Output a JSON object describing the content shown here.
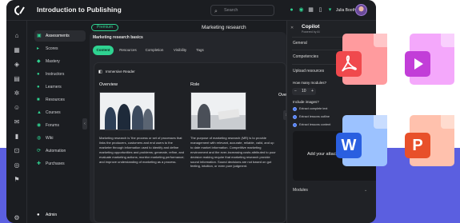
{
  "app": {
    "title": "Introduction to Publishing",
    "search_placeholder": "Search",
    "user_name": "Julia Booth"
  },
  "topbar_icons": [
    "bell-icon",
    "chat-icon",
    "calendar-icon",
    "trash-icon",
    "cart-icon"
  ],
  "rail_icons": [
    "home-icon",
    "grid-icon",
    "layers-icon",
    "book-icon",
    "settings-icon",
    "users-icon",
    "mail-icon",
    "chart-icon",
    "cart-icon",
    "globe-icon",
    "flag-icon",
    "gear-icon"
  ],
  "sidebar": {
    "items": [
      {
        "label": "Assessments",
        "icon": "clipboard-icon",
        "active": true
      },
      {
        "label": "Scores",
        "icon": "score-icon"
      },
      {
        "label": "Mastery",
        "icon": "mastery-icon"
      },
      {
        "label": "Instructors",
        "icon": "instructor-icon"
      },
      {
        "label": "Learners",
        "icon": "learners-icon"
      },
      {
        "label": "Resources",
        "icon": "resources-icon"
      },
      {
        "label": "Courses",
        "icon": "courses-icon"
      },
      {
        "label": "Forums",
        "icon": "forums-icon"
      },
      {
        "label": "Wiki",
        "icon": "wiki-icon"
      },
      {
        "label": "Automation",
        "icon": "automation-icon"
      },
      {
        "label": "Purchases",
        "icon": "purchases-icon"
      }
    ],
    "footer": "Admin"
  },
  "main": {
    "pill": "Premium",
    "title": "Marketing research",
    "card_subtitle": "Marketing research basics",
    "tabs": [
      "Content",
      "Resources",
      "Completion",
      "Visibility",
      "Tags"
    ],
    "inner_header": "Immersive Reader",
    "overview_heading": "Overview",
    "role_heading": "Role",
    "overview_text": "Marketing research is 'the process or set of processes that links the producers, customers and end users to the marketer through information used to identify and define marketing opportunities and problems; generate, refine, and evaluate marketing actions; monitor marketing performance; and improve understanding of marketing as a process.",
    "role_text": "The purpose of marketing research (MR) is to provide management with relevant, accurate, reliable, valid, and up to date market information. Competitive marketing environment and the ever-increasing costs attributed to poor decision making require that marketing research provide sound information. Sound decisions are not based on gut feeling, intuition, or even pure judgment.",
    "overview_right": "Overv"
  },
  "copilot": {
    "title": "Copilot",
    "subtitle": "Powered by AI",
    "rows": [
      "General",
      "Competencies",
      "Upload resources"
    ],
    "questions_label": "How many modules?",
    "questions_value": "10",
    "include_label": "Include images?",
    "radio_options": [
      "Extract complete text",
      "Extract lessons outline",
      "Extract lessons content"
    ],
    "upload_label": "Add your attachm",
    "modules_label": "Modules"
  },
  "file_icons": [
    {
      "name": "pdf-file-icon",
      "color": "#f0494d",
      "sheet": "#ff9b9e",
      "glyph": "acrobat"
    },
    {
      "name": "video-file-icon",
      "color": "#c23ed8",
      "sheet": "#f4a8fb",
      "glyph": "play"
    },
    {
      "name": "word-file-icon",
      "color": "#2a5fe0",
      "sheet": "#9cc2ff",
      "glyph": "W"
    },
    {
      "name": "powerpoint-file-icon",
      "color": "#e8502a",
      "sheet": "#ffc1ad",
      "glyph": "P"
    }
  ],
  "colors": {
    "accent": "#2fd391",
    "app_bg": "#1b1d21",
    "band": "#5b5fe0"
  }
}
